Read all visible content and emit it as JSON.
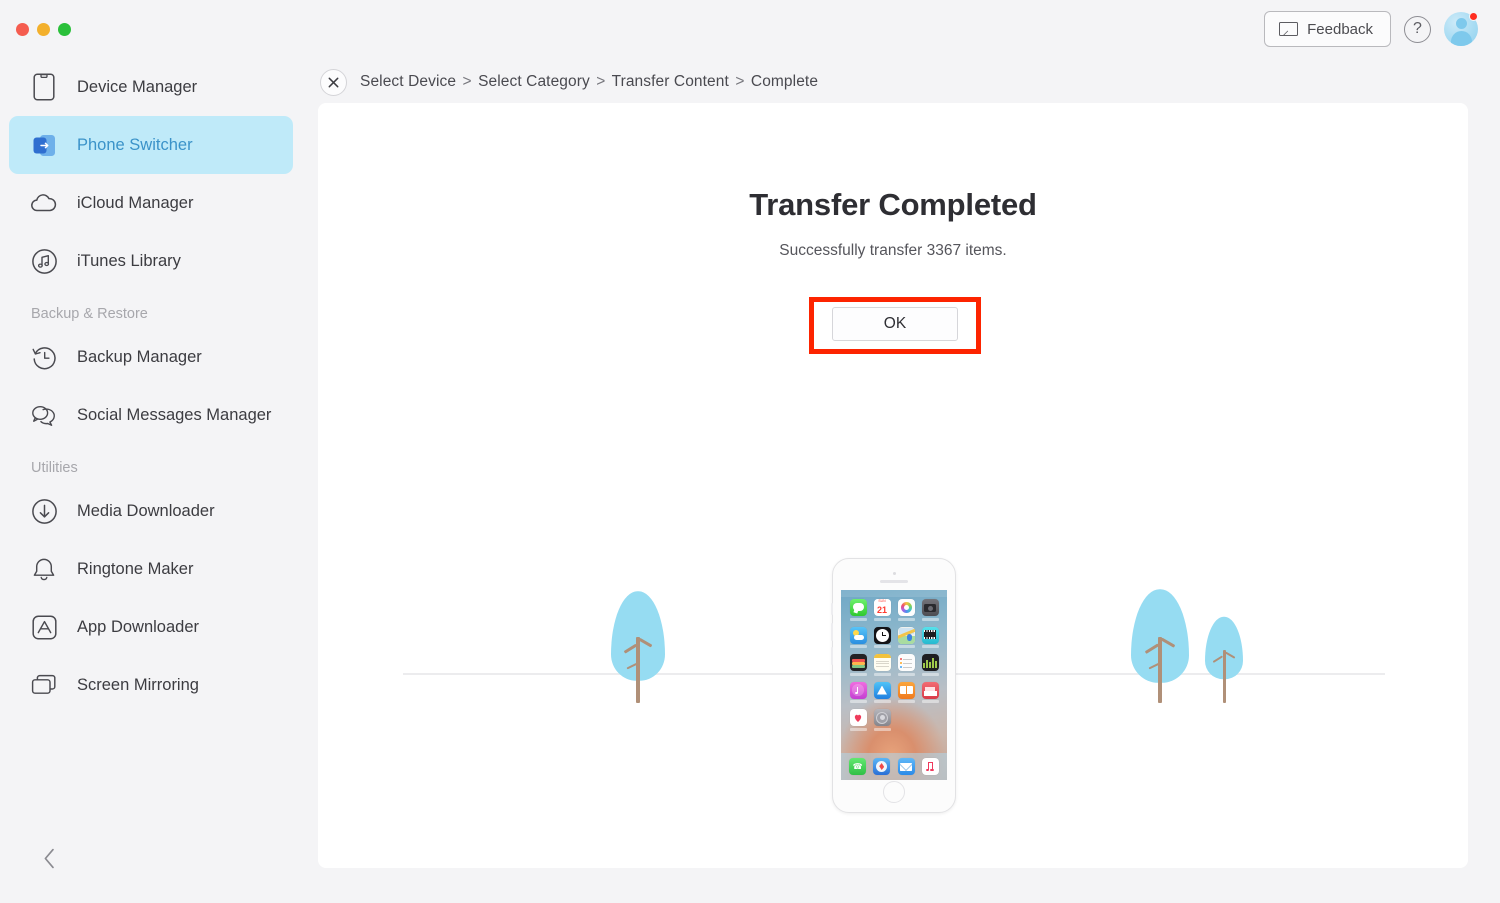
{
  "window": {
    "traffic_lights": [
      "close",
      "minimize",
      "maximize"
    ],
    "colors": {
      "close": "#f55c4f",
      "minimize": "#f3b02c",
      "maximize": "#2ac03a"
    }
  },
  "header": {
    "feedback_label": "Feedback",
    "feedback_icon": "envelope-icon",
    "help_icon": "question-mark-icon",
    "help_label": "?",
    "avatar_icon": "user-avatar-icon",
    "notification_badge": true
  },
  "sidebar": {
    "items": [
      {
        "label": "Device Manager",
        "icon": "phone-outline-icon",
        "active": false
      },
      {
        "label": "Phone Switcher",
        "icon": "phone-switcher-icon",
        "active": true
      },
      {
        "label": "iCloud Manager",
        "icon": "cloud-icon",
        "active": false
      },
      {
        "label": "iTunes Library",
        "icon": "music-note-circle-icon",
        "active": false
      }
    ],
    "group_backup": {
      "title": "Backup & Restore",
      "items": [
        {
          "label": "Backup Manager",
          "icon": "clock-restore-icon"
        },
        {
          "label": "Social Messages Manager",
          "icon": "chat-bubbles-icon"
        }
      ]
    },
    "group_utilities": {
      "title": "Utilities",
      "items": [
        {
          "label": "Media Downloader",
          "icon": "download-arrow-circle-icon"
        },
        {
          "label": "Ringtone Maker",
          "icon": "bell-icon"
        },
        {
          "label": "App Downloader",
          "icon": "app-store-icon"
        },
        {
          "label": "Screen Mirroring",
          "icon": "screens-stack-icon"
        }
      ]
    },
    "collapse_icon": "chevron-left-icon",
    "active_bg": "#bfeaf9",
    "active_text": "#3b93c9"
  },
  "breadcrumb": {
    "close_icon": "close-x-icon",
    "steps": [
      "Select Device",
      "Select Category",
      "Transfer Content",
      "Complete"
    ],
    "separator": ">"
  },
  "main": {
    "title": "Transfer Completed",
    "subtitle": "Successfully transfer 3367 items.",
    "ok_label": "OK",
    "highlight_color": "#fd2400",
    "item_count": 3367
  },
  "scene": {
    "phone_icon": "iphone-home-screen-illustration",
    "trees": [
      {
        "name": "tree-left",
        "size": "medium"
      },
      {
        "name": "tree-right-large",
        "size": "large"
      },
      {
        "name": "tree-right-small",
        "size": "small"
      }
    ],
    "tree_color": "#96dcf2",
    "trunk_color": "#b09078",
    "ground_color": "#ececee"
  },
  "phone_screen": {
    "apps": [
      {
        "name": "messages",
        "color": "#5ce061"
      },
      {
        "name": "calendar",
        "color": "#ffffff"
      },
      {
        "name": "photos",
        "color": "#fefefe"
      },
      {
        "name": "camera",
        "color": "#636369"
      },
      {
        "name": "weather",
        "color": "#52b5f0"
      },
      {
        "name": "clock",
        "color": "#1c1c1e"
      },
      {
        "name": "maps",
        "color": "#eceff1"
      },
      {
        "name": "videos",
        "color": "#3ecfe0"
      },
      {
        "name": "wallet",
        "color": "#2b2b2d"
      },
      {
        "name": "notes",
        "color": "#fdfdf6"
      },
      {
        "name": "reminders",
        "color": "#fbfbfb"
      },
      {
        "name": "stocks",
        "color": "#232326"
      },
      {
        "name": "itunes-store",
        "color": "#e457c4"
      },
      {
        "name": "app-store",
        "color": "#3aa7f0"
      },
      {
        "name": "ibooks",
        "color": "#f79032"
      },
      {
        "name": "newsstand",
        "color": "#ee4d55"
      },
      {
        "name": "health",
        "color": "#ffffff"
      },
      {
        "name": "settings",
        "color": "#8e8e93"
      }
    ],
    "dock": [
      {
        "name": "phone",
        "color": "#4cd964"
      },
      {
        "name": "safari",
        "color": "#3f8fe8"
      },
      {
        "name": "mail",
        "color": "#3aa5f5"
      },
      {
        "name": "music",
        "color": "#ffffff"
      }
    ]
  }
}
